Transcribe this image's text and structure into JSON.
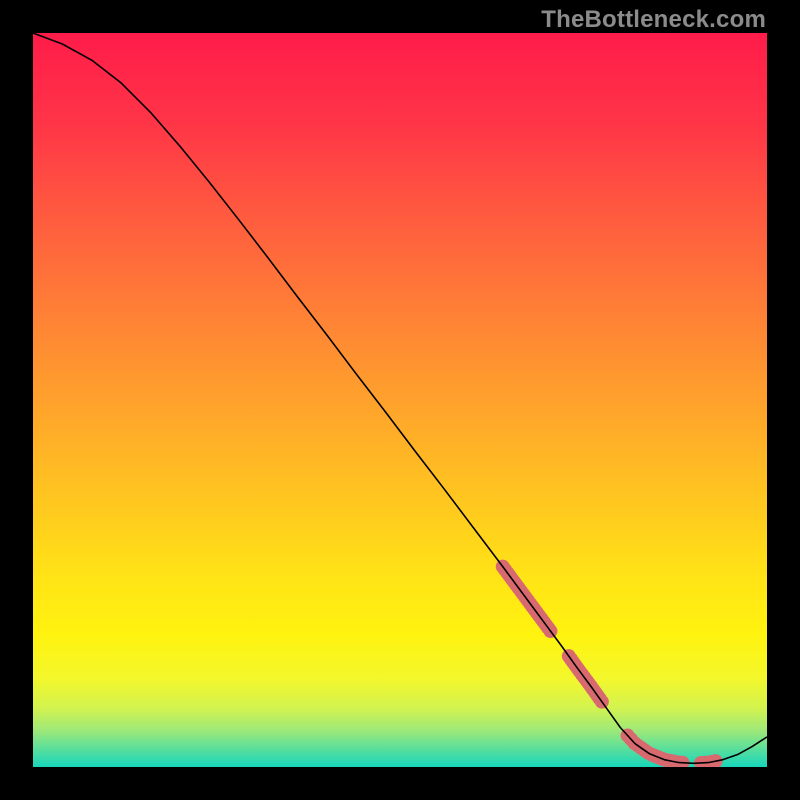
{
  "watermark": "TheBottleneck.com",
  "chart_data": {
    "type": "line",
    "title": "",
    "xlabel": "",
    "ylabel": "",
    "xlim": [
      0,
      100
    ],
    "ylim": [
      0,
      100
    ],
    "grid": false,
    "legend": false,
    "series": [
      {
        "name": "curve",
        "x": [
          0,
          4,
          8,
          12,
          16,
          20,
          24,
          28,
          32,
          36,
          40,
          44,
          48,
          52,
          56,
          60,
          64,
          68,
          70,
          72,
          74,
          76,
          78,
          80,
          82,
          84,
          86,
          88,
          90,
          92,
          94,
          96,
          98,
          100
        ],
        "y": [
          100.0,
          98.5,
          96.3,
          93.2,
          89.2,
          84.6,
          79.7,
          74.6,
          69.4,
          64.1,
          58.9,
          53.6,
          48.4,
          43.1,
          37.9,
          32.6,
          27.3,
          21.9,
          19.2,
          16.5,
          13.7,
          11.0,
          8.2,
          5.4,
          3.2,
          1.8,
          1.0,
          0.6,
          0.5,
          0.6,
          1.0,
          1.7,
          2.8,
          4.1
        ]
      }
    ],
    "markers": {
      "name": "dots",
      "x_ranges": [
        [
          64,
          70.5
        ],
        [
          73,
          77.5
        ],
        [
          81,
          88.5
        ],
        [
          91,
          93
        ]
      ],
      "color": "#d86a6f",
      "radius_px": 7
    },
    "background_gradient": {
      "stops": [
        {
          "pos": 0.0,
          "color": "#ff1c4a"
        },
        {
          "pos": 0.12,
          "color": "#ff3447"
        },
        {
          "pos": 0.25,
          "color": "#ff5b3f"
        },
        {
          "pos": 0.38,
          "color": "#ff8036"
        },
        {
          "pos": 0.5,
          "color": "#ffa12c"
        },
        {
          "pos": 0.62,
          "color": "#ffc221"
        },
        {
          "pos": 0.74,
          "color": "#ffe316"
        },
        {
          "pos": 0.82,
          "color": "#fff30f"
        },
        {
          "pos": 0.88,
          "color": "#f3f72c"
        },
        {
          "pos": 0.92,
          "color": "#d2f350"
        },
        {
          "pos": 0.95,
          "color": "#9ee978"
        },
        {
          "pos": 0.975,
          "color": "#5adf9b"
        },
        {
          "pos": 1.0,
          "color": "#17d6bb"
        }
      ]
    }
  }
}
